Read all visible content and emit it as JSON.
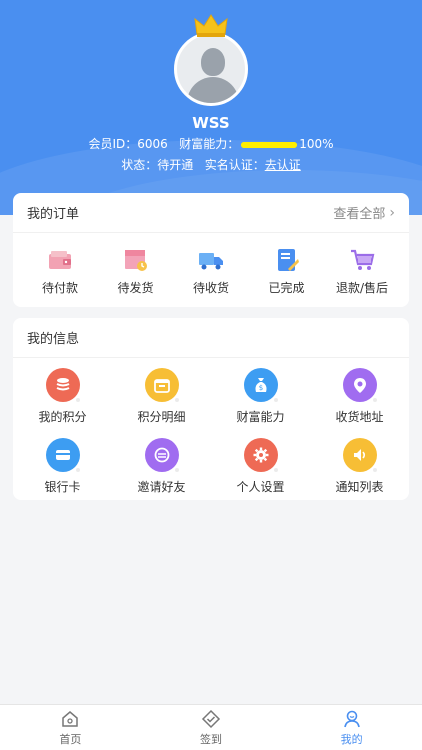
{
  "profile": {
    "username": "WSS",
    "member_id_label": "会员ID：",
    "member_id": "6006",
    "wealth_label": "财富能力：",
    "wealth_percent": "100%",
    "wealth_fraction": 1.0,
    "status_label": "状态：",
    "status_value": "待开通",
    "verify_label": "实名认证：",
    "verify_link": "去认证"
  },
  "orders": {
    "title": "我的订单",
    "view_all": "查看全部",
    "items": [
      {
        "label": "待付款",
        "icon": "wallet-icon"
      },
      {
        "label": "待发货",
        "icon": "package-icon"
      },
      {
        "label": "待收货",
        "icon": "truck-icon"
      },
      {
        "label": "已完成",
        "icon": "clipboard-check-icon"
      },
      {
        "label": "退款/售后",
        "icon": "cart-return-icon"
      }
    ]
  },
  "info": {
    "title": "我的信息",
    "items": [
      {
        "label": "我的积分",
        "icon": "coins-icon",
        "color": "#ee6a55"
      },
      {
        "label": "积分明细",
        "icon": "calendar-icon",
        "color": "#f7be35"
      },
      {
        "label": "财富能力",
        "icon": "money-bag-icon",
        "color": "#3d9df2"
      },
      {
        "label": "收货地址",
        "icon": "location-pin-icon",
        "color": "#a06cf0"
      },
      {
        "label": "银行卡",
        "icon": "bank-card-icon",
        "color": "#3d9df2"
      },
      {
        "label": "邀请好友",
        "icon": "invite-icon",
        "color": "#a06cf0"
      },
      {
        "label": "个人设置",
        "icon": "gear-icon",
        "color": "#ee6a55"
      },
      {
        "label": "通知列表",
        "icon": "speaker-icon",
        "color": "#f7be35"
      }
    ]
  },
  "tabs": [
    {
      "label": "首页",
      "icon": "home-icon",
      "active": false
    },
    {
      "label": "签到",
      "icon": "checkin-icon",
      "active": false
    },
    {
      "label": "我的",
      "icon": "profile-icon",
      "active": true
    }
  ],
  "colors": {
    "header": "#4a8ff0",
    "accent": "#4a8ff0",
    "progress": "#ffee00"
  }
}
